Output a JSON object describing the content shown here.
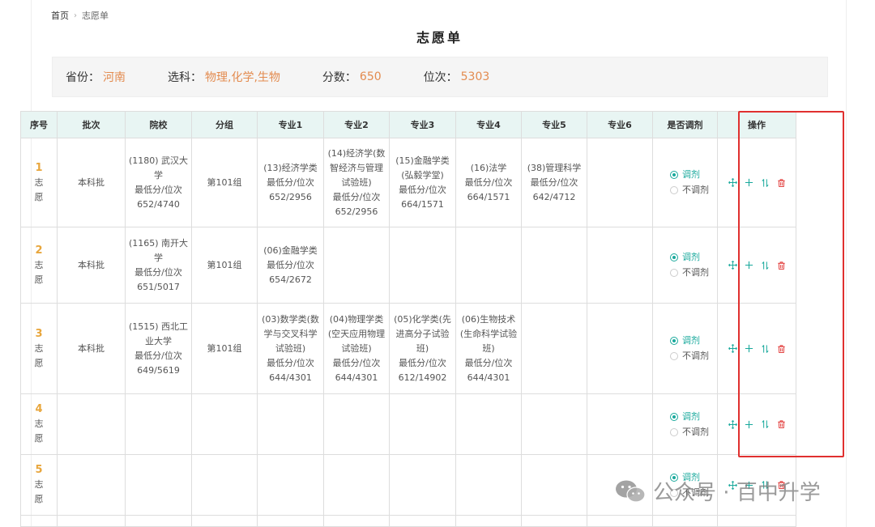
{
  "breadcrumb": {
    "home": "首页",
    "current": "志愿单"
  },
  "page_title": "志愿单",
  "info": {
    "province_label": "省份：",
    "province": "河南",
    "subjects_label": "选科：",
    "subjects": "物理,化学,生物",
    "score_label": "分数：",
    "score": "650",
    "rank_label": "位次：",
    "rank": "5303"
  },
  "table": {
    "headers": [
      "序号",
      "批次",
      "院校",
      "分组",
      "专业1",
      "专业2",
      "专业3",
      "专业4",
      "专业5",
      "专业6",
      "是否调剂",
      "操作"
    ],
    "rows": [
      {
        "num": "1",
        "zhi": "志",
        "yuan": "愿",
        "batch": "本科批",
        "school": [
          "(1180) 武汉大",
          "学",
          "最低分/位次",
          "652/4740"
        ],
        "group": "第101组",
        "majors": [
          [
            "(13)经济学类",
            "最低分/位次",
            "652/2956"
          ],
          [
            "(14)经济学(数",
            "智经济与管理",
            "试验班)",
            "最低分/位次",
            "652/2956"
          ],
          [
            "(15)金融学类",
            "(弘毅学堂)",
            "最低分/位次",
            "664/1571"
          ],
          [
            "(16)法学",
            "最低分/位次",
            "664/1571"
          ],
          [
            "(38)管理科学",
            "最低分/位次",
            "642/4712"
          ],
          []
        ],
        "adjust_yes": "调剂",
        "adjust_no": "不调剂"
      },
      {
        "num": "2",
        "zhi": "志",
        "yuan": "愿",
        "batch": "本科批",
        "school": [
          "(1165) 南开大",
          "学",
          "最低分/位次",
          "651/5017"
        ],
        "group": "第101组",
        "majors": [
          [
            "(06)金融学类",
            "最低分/位次",
            "654/2672"
          ],
          [],
          [],
          [],
          [],
          []
        ],
        "adjust_yes": "调剂",
        "adjust_no": "不调剂"
      },
      {
        "num": "3",
        "zhi": "志",
        "yuan": "愿",
        "batch": "本科批",
        "school": [
          "(1515) 西北工",
          "业大学",
          "最低分/位次",
          "649/5619"
        ],
        "group": "第101组",
        "majors": [
          [
            "(03)数学类(数",
            "学与交叉科学",
            "试验班)",
            "最低分/位次",
            "644/4301"
          ],
          [
            "(04)物理学类",
            "(空天应用物理",
            "试验班)",
            "最低分/位次",
            "644/4301"
          ],
          [
            "(05)化学类(先",
            "进高分子试验",
            "班)",
            "最低分/位次",
            "612/14902"
          ],
          [
            "(06)生物技术",
            "(生命科学试验",
            "班)",
            "最低分/位次",
            "644/4301"
          ],
          [],
          []
        ],
        "adjust_yes": "调剂",
        "adjust_no": "不调剂"
      },
      {
        "num": "4",
        "zhi": "志",
        "yuan": "愿",
        "batch": "",
        "school": [],
        "group": "",
        "majors": [
          [],
          [],
          [],
          [],
          [],
          []
        ],
        "adjust_yes": "调剂",
        "adjust_no": "不调剂"
      },
      {
        "num": "5",
        "zhi": "志",
        "yuan": "愿",
        "batch": "",
        "school": [],
        "group": "",
        "majors": [
          [],
          [],
          [],
          [],
          [],
          []
        ],
        "adjust_yes": "调剂",
        "adjust_no": "不调剂"
      }
    ],
    "ops": [
      "move-icon",
      "add-icon",
      "sort-icon",
      "delete-icon"
    ]
  },
  "colors": {
    "accent": "#19a99c",
    "score": "#e38b4f",
    "index": "#e8a63c",
    "delete": "#e0302f",
    "highlight_box": "#e0302f"
  },
  "watermark": {
    "text": "公众号 · 百中升学"
  }
}
